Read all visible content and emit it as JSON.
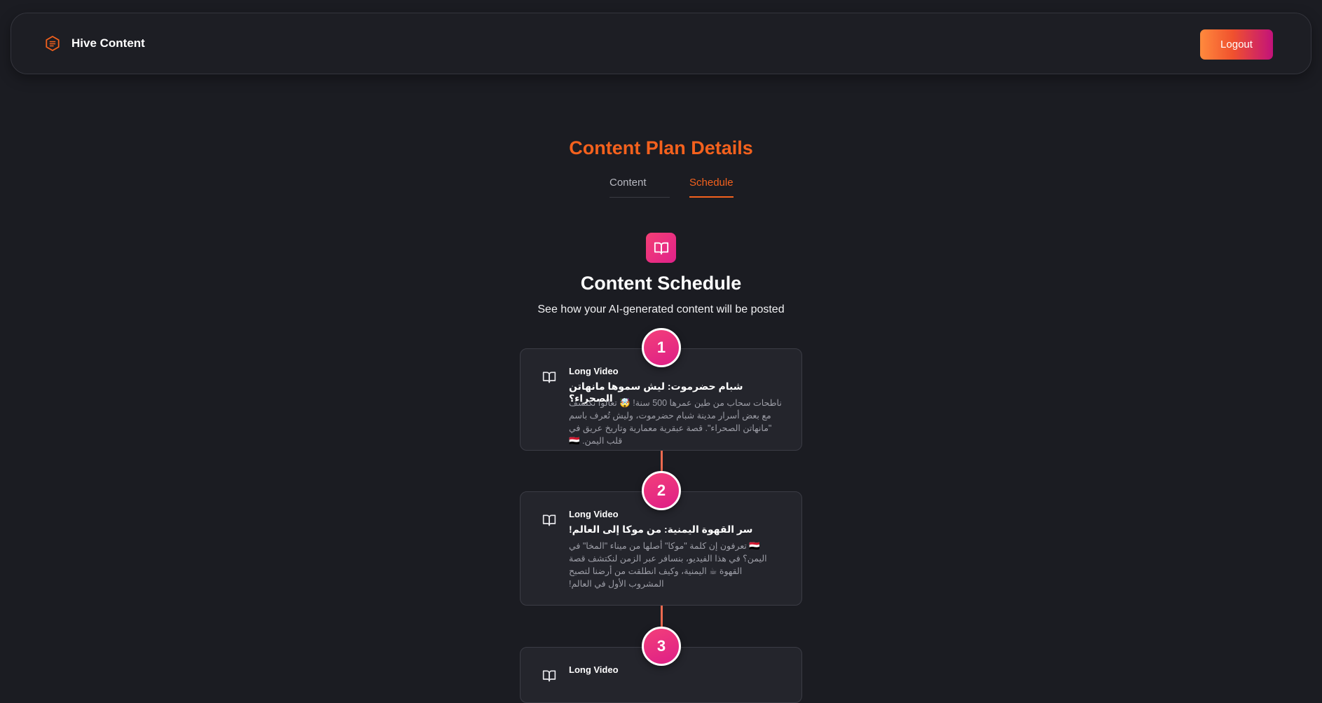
{
  "brand": {
    "name": "Hive Content",
    "icon": "document-hexagon-icon"
  },
  "header": {
    "logout_label": "Logout"
  },
  "page": {
    "title": "Content Plan Details"
  },
  "tabs": [
    {
      "label": "Content",
      "active": false
    },
    {
      "label": "Schedule",
      "active": true
    }
  ],
  "schedule": {
    "icon": "book-open-icon",
    "title": "Content Schedule",
    "subtitle": "See how your AI-generated content will be posted",
    "items": [
      {
        "step": "1",
        "type": "Long Video",
        "title": "شبام حضرموت: ليش سموها مانهاتن الصحراء؟",
        "description": "ناطحات سحاب من طين عمرها 500 سنة! 🤯 تعالوا نكتشف مع بعض أسرار مدينة شبام حضرموت، وليش تُعرف باسم \"مانهاتن الصحراء\". قصة عبقرية معمارية وتاريخ عريق في قلب اليمن. 🇾🇪"
      },
      {
        "step": "2",
        "type": "Long Video",
        "title": "سر القهوة اليمنية: من موكا إلى العالم!",
        "description": "🇾🇪 تعرفون إن كلمة \"موكا\" أصلها من ميناء \"المخا\" في اليمن؟ في هذا الفيديو، بنسافر عبر الزمن لنكتشف قصة القهوة ☕ اليمنية، وكيف انطلقت من أرضنا لتصبح المشروب الأول في العالم!"
      },
      {
        "step": "3",
        "type": "Long Video",
        "title": "",
        "description": ""
      }
    ]
  },
  "colors": {
    "accent": "#f4611d",
    "step_gradient_start": "#f33f7a",
    "step_gradient_end": "#de1f87",
    "background": "#1b1c22",
    "card": "#24252c"
  }
}
